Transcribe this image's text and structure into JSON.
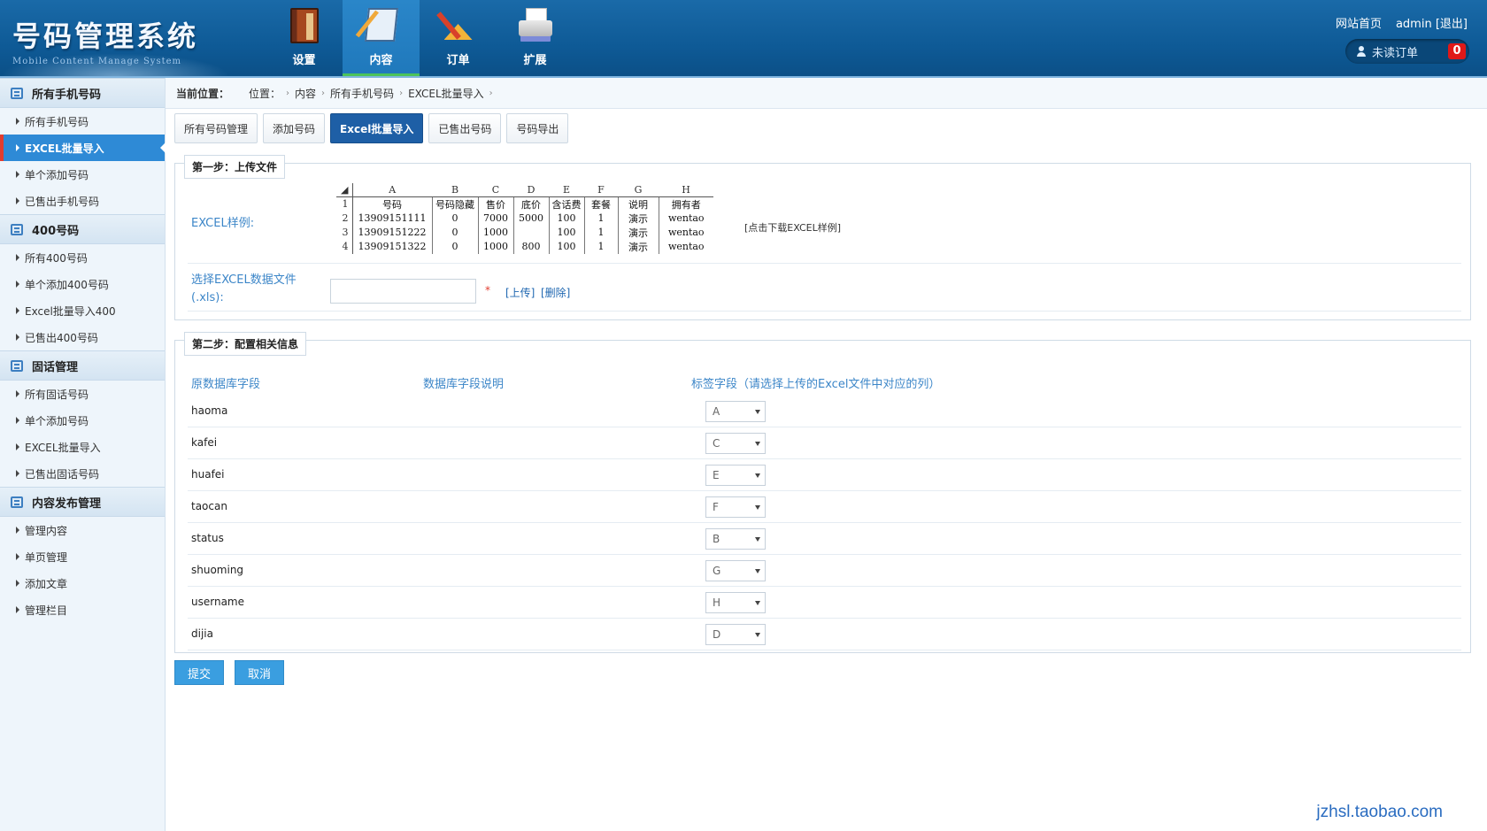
{
  "header": {
    "logo_title": "号码管理系统",
    "logo_subtitle": "Mobile Content Manage System",
    "nav": [
      {
        "label": "设置",
        "icon": "settings-book-icon"
      },
      {
        "label": "内容",
        "icon": "content-pad-icon"
      },
      {
        "label": "订单",
        "icon": "order-tools-icon"
      },
      {
        "label": "扩展",
        "icon": "extend-printer-icon"
      }
    ],
    "active_nav": "内容",
    "site_home": "网站首页",
    "user": "admin",
    "logout": "[退出]",
    "unread_orders_label": "未读订单",
    "unread_orders_count": "0"
  },
  "sidebar": {
    "groups": [
      {
        "title": "所有手机号码",
        "items": [
          "所有手机号码",
          "EXCEL批量导入",
          "单个添加号码",
          "已售出手机号码"
        ]
      },
      {
        "title": "400号码",
        "items": [
          "所有400号码",
          "单个添加400号码",
          "Excel批量导入400",
          "已售出400号码"
        ]
      },
      {
        "title": "固话管理",
        "items": [
          "所有固话号码",
          "单个添加号码",
          "EXCEL批量导入",
          "已售出固话号码"
        ]
      },
      {
        "title": "内容发布管理",
        "items": [
          "管理内容",
          "单页管理",
          "添加文章",
          "管理栏目"
        ]
      }
    ],
    "active_item": "EXCEL批量导入"
  },
  "breadcrumb": {
    "current_label": "当前位置：",
    "position_label": "位置：",
    "path": [
      "内容",
      "所有手机号码",
      "EXCEL批量导入"
    ]
  },
  "tabs": [
    "所有号码管理",
    "添加号码",
    "Excel批量导入",
    "已售出号码",
    "号码导出"
  ],
  "active_tab": "Excel批量导入",
  "step1": {
    "legend": "第一步：上传文件",
    "sample_label": "EXCEL样例:",
    "sample_columns": [
      "A",
      "B",
      "C",
      "D",
      "E",
      "F",
      "G",
      "H"
    ],
    "sample_rows": [
      [
        "1",
        "号码",
        "号码隐藏",
        "售价",
        "底价",
        "含话费",
        "套餐",
        "说明",
        "拥有者"
      ],
      [
        "2",
        "13909151111",
        "0",
        "7000",
        "5000",
        "100",
        "1",
        "演示",
        "wentao"
      ],
      [
        "3",
        "13909151222",
        "0",
        "1000",
        "",
        "100",
        "1",
        "演示",
        "wentao"
      ],
      [
        "4",
        "13909151322",
        "0",
        "1000",
        "800",
        "100",
        "1",
        "演示",
        "wentao"
      ]
    ],
    "download_link": "[点击下载EXCEL样例]",
    "file_label": "选择EXCEL数据文件(.xls):",
    "file_value": "",
    "required_mark": "*",
    "upload_link": "[上传]",
    "delete_link": "[删除]"
  },
  "step2": {
    "legend": "第二步：配置相关信息",
    "col_headers": [
      "原数据库字段",
      "数据库字段说明",
      "标签字段（请选择上传的Excel文件中对应的列）"
    ],
    "fields": [
      {
        "name": "haoma",
        "desc": "",
        "column": "A"
      },
      {
        "name": "kafei",
        "desc": "",
        "column": "C"
      },
      {
        "name": "huafei",
        "desc": "",
        "column": "E"
      },
      {
        "name": "taocan",
        "desc": "",
        "column": "F"
      },
      {
        "name": "status",
        "desc": "",
        "column": "B"
      },
      {
        "name": "shuoming",
        "desc": "",
        "column": "G"
      },
      {
        "name": "username",
        "desc": "",
        "column": "H"
      },
      {
        "name": "dijia",
        "desc": "",
        "column": "D"
      }
    ]
  },
  "buttons": {
    "submit": "提交",
    "cancel": "取消"
  },
  "watermark": "jzhsl.taobao.com",
  "colors": {
    "header": "#0e5a96",
    "active_tab": "#1e5fa6",
    "active_side": "#2e8ad6",
    "button": "#3a9ee0",
    "label": "#3c86c8"
  }
}
